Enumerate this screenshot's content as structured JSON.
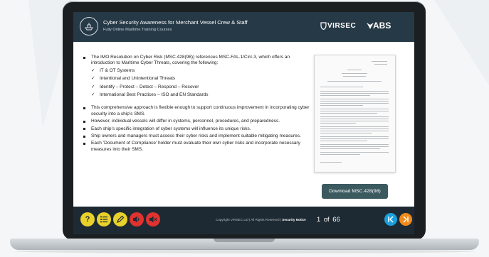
{
  "header": {
    "title": "Cyber Security Awareness for Merchant Vessel Crew & Staff",
    "subtitle": "Fully Online Maritime Training Courses",
    "brand_virsec": "VIRSEC",
    "brand_abs": "ABS"
  },
  "content": {
    "bullets_top": [
      "The IMO Resolution on Cyber Risk (MSC.428(98)) references MSC-FAL.1/Circ.3, which offers an introduction to Maritime Cyber Threats, covering the following:"
    ],
    "sub_items": [
      "IT & OT Systems",
      "Intentional and Unintentional Threats",
      "Identify – Protect – Detect – Respond – Recover",
      "International Best Practices – ISO and EN Standards"
    ],
    "bullets_bottom": [
      "This comprehensive approach is flexible enough to support continuous improvement in incorporating cyber security into a ship’s SMS.",
      "However, individual vessels will differ in systems, personnel, procedures, and preparedness.",
      "Each ship’s specific integration of cyber systems will influence its unique risks.",
      "Ship owners and managers must assess their cyber risks and implement suitable mitigating measures.",
      "Each ‘Document of Compliance’ holder must evaluate their own cyber risks and incorporate necessary measures into their SMS."
    ],
    "download_label": "Download MSC.428(98)"
  },
  "footer": {
    "copyright": "Copyright VIRSEC Ltd  |  All Rights Reserved  |",
    "security_notice": "Security Notice",
    "current_page": "1",
    "of_label": "of",
    "total_pages": "66",
    "icons": [
      "help-icon",
      "menu-list-icon",
      "pencil-icon",
      "audio-icon",
      "mute-icon",
      "back-icon",
      "next-icon"
    ]
  },
  "colors": {
    "header_bg": "#263946",
    "footer_bg": "#1e2a33",
    "help_btn": "#e9d12b",
    "red_btn": "#e0322f",
    "back_btn": "#1aa0dc",
    "next_btn": "#f08a1c",
    "download_btn": "#3a5a60"
  }
}
